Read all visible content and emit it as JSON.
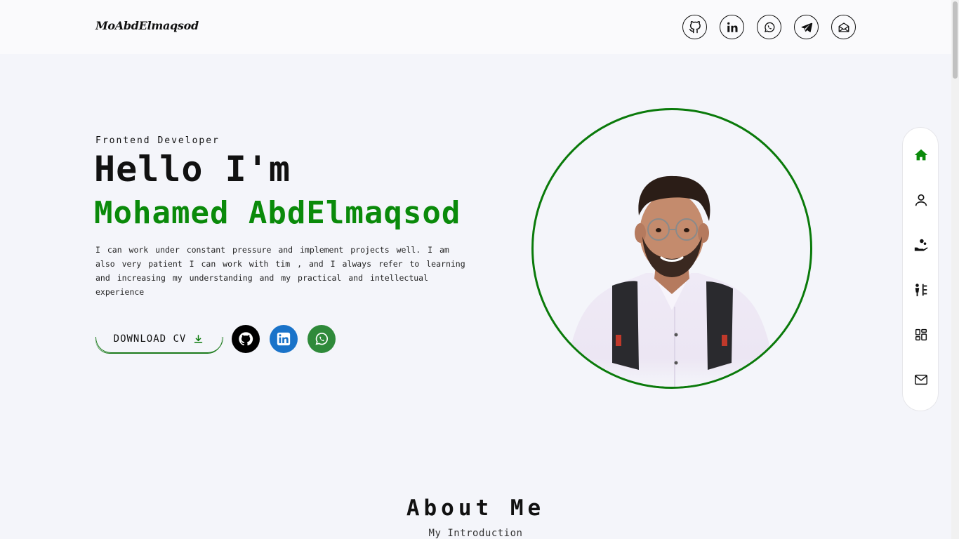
{
  "header": {
    "logo": "MoAbdElmaqsod",
    "icons": [
      "github-icon",
      "linkedin-icon",
      "whatsapp-icon",
      "telegram-icon",
      "mail-open-icon"
    ]
  },
  "hero": {
    "role": "Frontend Developer",
    "greeting": "Hello I'm",
    "name": "Mohamed AbdElmaqsod",
    "description": "I can work under constant pressure and implement projects well. I am also very patient I can work with tim , and I always refer to learning and increasing my understanding and my practical and intellectual experience",
    "cv_button": "DOWNLOAD CV",
    "socials": [
      "github-icon",
      "linkedin-icon",
      "whatsapp-icon"
    ]
  },
  "sidenav": {
    "items": [
      "home-icon",
      "user-icon",
      "services-icon",
      "resume-icon",
      "portfolio-icon",
      "mail-icon"
    ],
    "active": "home-icon"
  },
  "about": {
    "title": "About Me",
    "subtitle": "My Introduction"
  },
  "colors": {
    "accent": "#0a8a0a",
    "background": "#f4f5fa",
    "linkedin": "#1a73c9",
    "whatsapp": "#2f8a3a"
  }
}
